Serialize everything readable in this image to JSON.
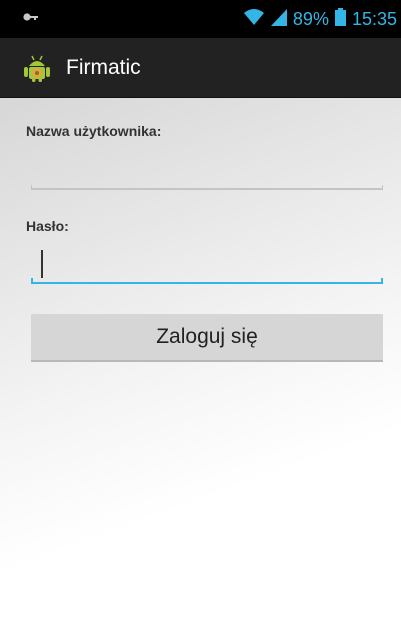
{
  "status_bar": {
    "battery": "89%",
    "time": "15:35",
    "icons": [
      "key-icon",
      "wifi-icon",
      "signal-icon",
      "battery-icon"
    ],
    "accent_color": "#33b5e5"
  },
  "action_bar": {
    "app_icon": "android-icon",
    "title": "Firmatic",
    "background": "#222222"
  },
  "form": {
    "username_label": "Nazwa użytkownika:",
    "username_value": "",
    "password_label": "Hasło:",
    "password_value": "",
    "login_button": "Zaloguj się",
    "focus_color": "#33b5e5"
  }
}
